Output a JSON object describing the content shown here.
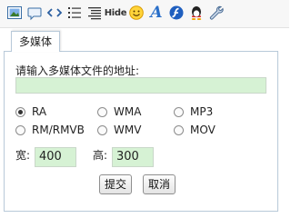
{
  "toolbar": {
    "buttons": [
      {
        "icon": "image-icon"
      },
      {
        "icon": "comment-icon"
      },
      {
        "icon": "code-icon"
      },
      {
        "icon": "ordered-list-icon"
      },
      {
        "icon": "unordered-list-icon"
      },
      {
        "icon": "hide-icon",
        "label": "Hide"
      },
      {
        "icon": "smiley-icon"
      },
      {
        "icon": "font-icon",
        "label": "A"
      },
      {
        "icon": "flash-icon"
      },
      {
        "icon": "qq-icon"
      },
      {
        "icon": "tools-icon"
      }
    ]
  },
  "tab": {
    "label": "多媒体"
  },
  "form": {
    "prompt": "请输入多媒体文件的地址:",
    "url_value": "",
    "formats": [
      {
        "label": "RA",
        "checked": true
      },
      {
        "label": "WMA",
        "checked": false
      },
      {
        "label": "MP3",
        "checked": false
      },
      {
        "label": "RM/RMVB",
        "checked": false
      },
      {
        "label": "WMV",
        "checked": false
      },
      {
        "label": "MOV",
        "checked": false
      }
    ],
    "width_label": "宽:",
    "width_value": "400",
    "height_label": "高:",
    "height_value": "300",
    "submit_label": "提交",
    "cancel_label": "取消"
  },
  "colors": {
    "input_bg": "#d6f2d4",
    "border": "#b8c9d9"
  }
}
